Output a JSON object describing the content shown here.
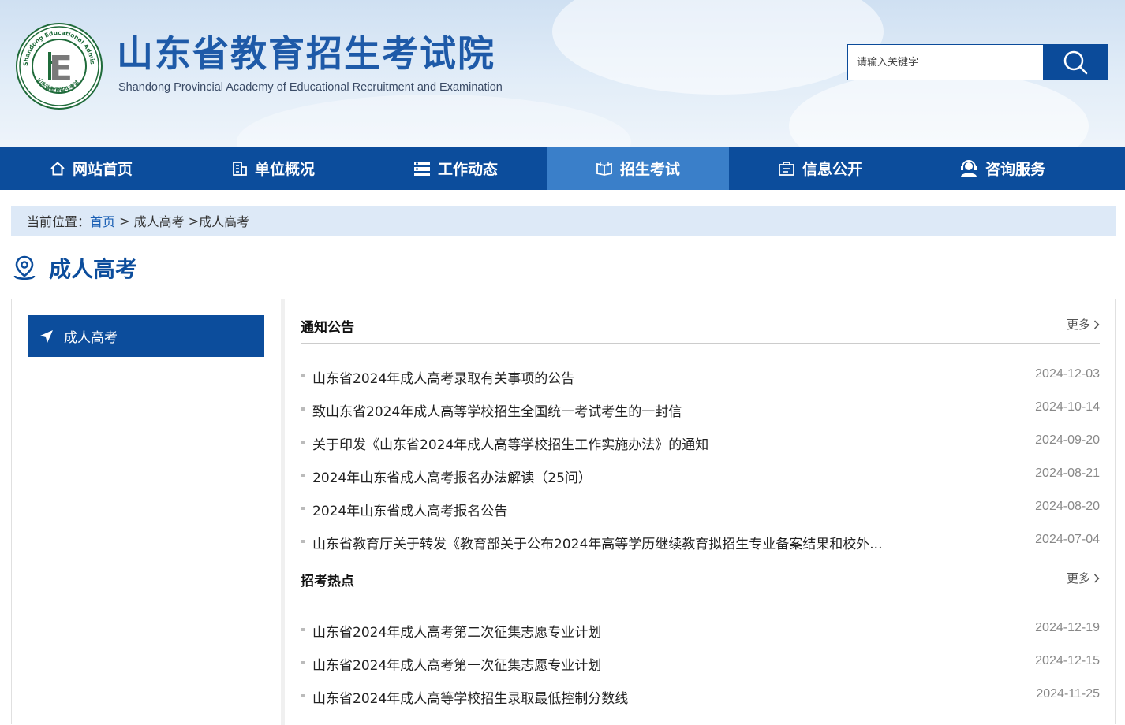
{
  "header": {
    "site_title": "山东省教育招生考试院",
    "site_subtitle": "Shandong Provincial Academy of Educational Recruitment and Examination",
    "emblem_text": "Shandong Educational Admission & Examination",
    "emblem_bottom_text": "山东省教育招生考试",
    "emblem_letter": "E",
    "search": {
      "placeholder": "请输入关键字",
      "value": ""
    }
  },
  "nav": {
    "items": [
      {
        "label": "网站首页",
        "icon": "home-icon"
      },
      {
        "label": "单位概况",
        "icon": "building-icon"
      },
      {
        "label": "工作动态",
        "icon": "news-icon"
      },
      {
        "label": "招生考试",
        "icon": "book-icon",
        "active": true
      },
      {
        "label": "信息公开",
        "icon": "info-box-icon"
      },
      {
        "label": "咨询服务",
        "icon": "support-icon"
      }
    ]
  },
  "breadcrumb": {
    "prefix": "当前位置：",
    "home": "首页",
    "sep1": " > ",
    "level1": "成人高考",
    "sep2": " >",
    "level2": "成人高考"
  },
  "section_title": "成人高考",
  "sidebar": {
    "items": [
      {
        "label": "成人高考",
        "icon": "send-arrow-icon"
      }
    ]
  },
  "blocks": [
    {
      "title": "通知公告",
      "more": "更多",
      "items": [
        {
          "title": "山东省2024年成人高考录取有关事项的公告",
          "date": "2024-12-03"
        },
        {
          "title": "致山东省2024年成人高等学校招生全国统一考试考生的一封信",
          "date": "2024-10-14"
        },
        {
          "title": "关于印发《山东省2024年成人高等学校招生工作实施办法》的通知",
          "date": "2024-09-20"
        },
        {
          "title": "2024年山东省成人高考报名办法解读（25问）",
          "date": "2024-08-21"
        },
        {
          "title": "2024年山东省成人高考报名公告",
          "date": "2024-08-20"
        },
        {
          "title": "山东省教育厅关于转发《教育部关于公布2024年高等学历继续教育拟招生专业备案结果和校外...",
          "date": "2024-07-04"
        }
      ]
    },
    {
      "title": "招考热点",
      "more": "更多",
      "items": [
        {
          "title": "山东省2024年成人高考第二次征集志愿专业计划",
          "date": "2024-12-19"
        },
        {
          "title": "山东省2024年成人高考第一次征集志愿专业计划",
          "date": "2024-12-15"
        },
        {
          "title": "山东省2024年成人高等学校招生录取最低控制分数线",
          "date": "2024-11-25"
        }
      ]
    }
  ],
  "colors": {
    "primary": "#0c4d9c",
    "active_nav": "#3a7fc9",
    "breadcrumb_bg": "#dde9f7",
    "link": "#1a5fb4"
  }
}
